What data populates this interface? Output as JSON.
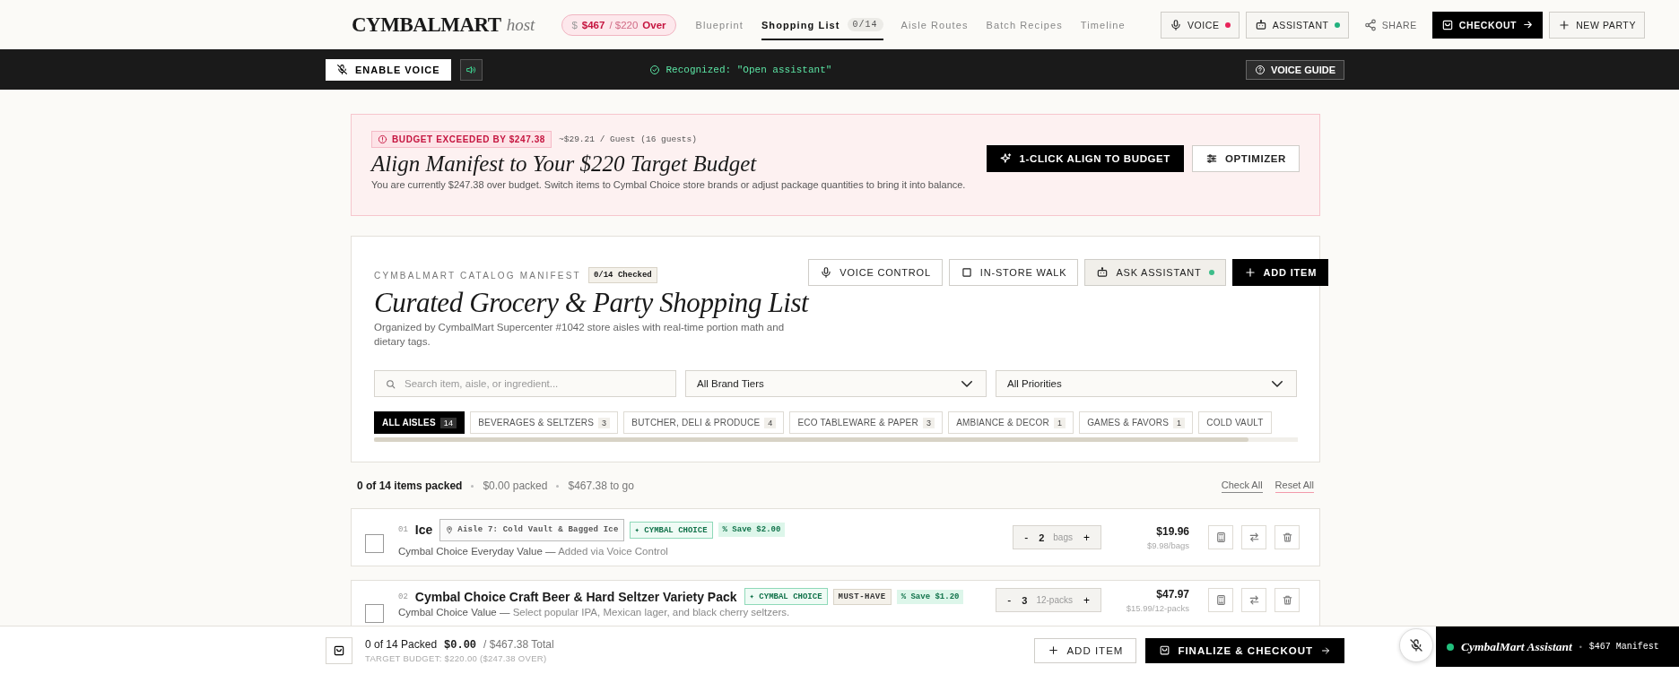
{
  "nav": {
    "logo": "CYMBALMART",
    "logo_suffix": "host",
    "budget": {
      "symbol": "$",
      "spent": "$467",
      "target": "/ $220",
      "status": "Over"
    },
    "links": [
      {
        "label": "Blueprint",
        "selected": false
      },
      {
        "label": "Shopping List",
        "selected": true,
        "badge": "0/14"
      },
      {
        "label": "Aisle Routes",
        "selected": false
      },
      {
        "label": "Batch Recipes",
        "selected": false
      },
      {
        "label": "Timeline",
        "selected": false
      }
    ],
    "actions": [
      {
        "kind": "outline",
        "label": "VOICE",
        "color": "#e8245a"
      },
      {
        "kind": "outline",
        "label": "ASSISTANT",
        "color": "#22b07d"
      },
      {
        "kind": "plain",
        "label": "SHARE"
      },
      {
        "kind": "primary",
        "label": "CHECKOUT"
      },
      {
        "kind": "outline",
        "label": "NEW PARTY"
      }
    ]
  },
  "voice_bar": {
    "enable_button": "ENABLE VOICE",
    "status": "Recognized: \"Open assistant\"",
    "guide_button": "VOICE GUIDE"
  },
  "budget_banner": {
    "alert": "BUDGET EXCEEDED BY $247.38",
    "per_guest": "~$29.21 / Guest (16 guests)",
    "title": "Align Manifest to Your $220 Target Budget",
    "text": "You are currently $247.38 over budget. Switch items to Cymbal Choice store brands or adjust package quantities to bring it into balance.",
    "buttons": [
      {
        "kind": "primary",
        "label": "1-CLICK ALIGN TO BUDGET"
      },
      {
        "kind": "outline",
        "label": "OPTIMIZER"
      }
    ]
  },
  "catalog": {
    "eyebrow": "CYMBALMART CATALOG MANIFEST",
    "badge": "0/14 Checked",
    "title": "Curated Grocery & Party Shopping List",
    "description": "Organized by CymbalMart Supercenter #1042 store aisles with real-time portion math and dietary tags.",
    "actions": [
      {
        "kind": "outline",
        "label": "VOICE CONTROL"
      },
      {
        "kind": "outline",
        "label": "IN-STORE WALK"
      },
      {
        "kind": "tinted",
        "label": "ASK ASSISTANT",
        "color": "#3dbd8a"
      },
      {
        "kind": "primary",
        "label": "ADD ITEM"
      }
    ],
    "search": {
      "placeholder": "Search item, aisle, or ingredient..."
    },
    "filters": [
      "All Brand Tiers",
      "All Priorities"
    ],
    "aisles": [
      {
        "label": "ALL AISLES",
        "count": "14",
        "selected": true
      },
      {
        "label": "BEVERAGES & SELTZERS",
        "count": "3",
        "selected": false
      },
      {
        "label": "BUTCHER, DELI & PRODUCE",
        "count": "4",
        "selected": false
      },
      {
        "label": "ECO TABLEWARE & PAPER",
        "count": "3",
        "selected": false
      },
      {
        "label": "AMBIANCE & DECOR",
        "count": "1",
        "selected": false
      },
      {
        "label": "GAMES & FAVORS",
        "count": "1",
        "selected": false
      },
      {
        "label": "COLD VAULT",
        "selected": false
      }
    ]
  },
  "summary": {
    "packed_items": "0 of 14 items packed",
    "packed_value": "$0.00 packed",
    "to_go": "$467.38 to go",
    "links": [
      "Check All",
      "Reset All"
    ]
  },
  "items": [
    {
      "number": "01",
      "name": "Ice",
      "checked": false,
      "tags": [
        {
          "kind": "aisle",
          "label": "Aisle 7: Cold Vault & Bagged Ice"
        },
        {
          "kind": "brand",
          "label": "✦ CYMBAL CHOICE"
        },
        {
          "kind": "save",
          "label": "% Save $2.00"
        }
      ],
      "brand": "Cymbal Choice Everyday Value —",
      "note": "Added via Voice Control",
      "minus": "-",
      "qty": "2",
      "unit": "bags",
      "plus": "+",
      "price": "$19.96",
      "unit_price": "$9.98/bags"
    },
    {
      "number": "02",
      "name": "Cymbal Choice Craft Beer & Hard Seltzer Variety Pack",
      "checked": false,
      "tags": [
        {
          "kind": "brand",
          "label": "✦ CYMBAL CHOICE"
        },
        {
          "kind": "priority",
          "label": "MUST-HAVE"
        },
        {
          "kind": "save",
          "label": "% Save $1.20"
        }
      ],
      "brand": "Cymbal Choice Value —",
      "note": "Select popular IPA, Mexican lager, and black cherry seltzers.",
      "minus": "-",
      "qty": "3",
      "unit": "12-packs",
      "plus": "+",
      "price": "$47.97",
      "unit_price": "$15.99/12-packs"
    }
  ],
  "footer": {
    "packed": "0 of 14 Packed",
    "packed_value": "$0.00",
    "total": "/ $467.38 Total",
    "target": "TARGET BUDGET: $220.00 ($247.38 OVER)",
    "buttons": [
      {
        "kind": "outline",
        "label": "ADD ITEM"
      },
      {
        "kind": "primary",
        "label": "FINALIZE & CHECKOUT"
      }
    ],
    "assistant": {
      "color": "#22c07d",
      "title": "CymbalMart Assistant",
      "separator": "•",
      "manifest": "$467 Manifest"
    }
  }
}
